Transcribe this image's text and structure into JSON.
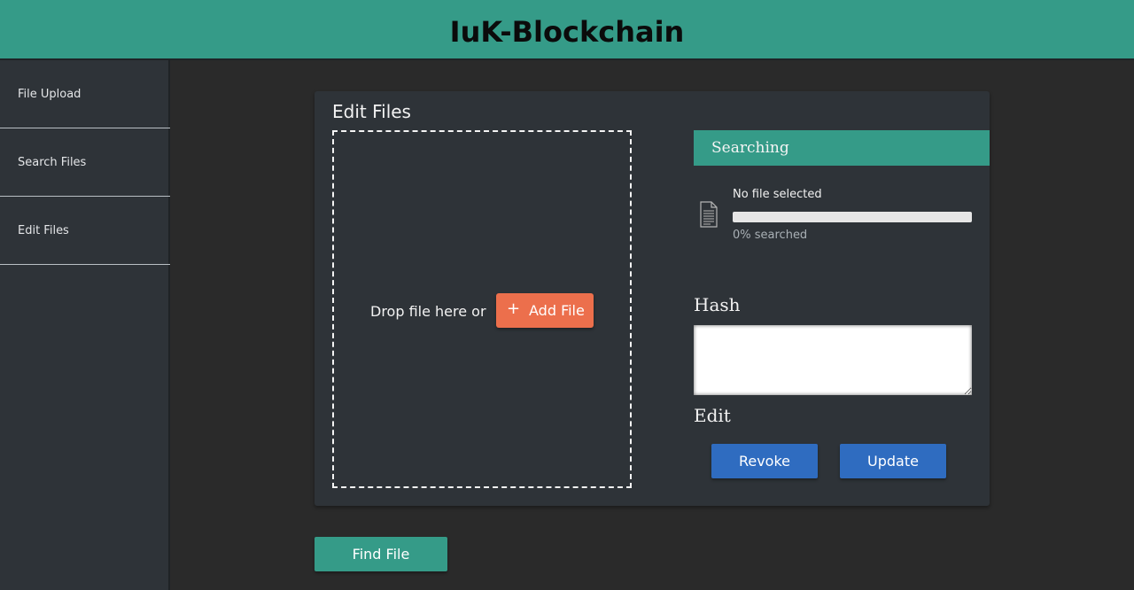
{
  "app": {
    "title": "IuK-Blockchain"
  },
  "sidebar": {
    "items": [
      {
        "label": "File Upload"
      },
      {
        "label": "Search Files"
      },
      {
        "label": "Edit Files"
      }
    ]
  },
  "card": {
    "title": "Edit Files",
    "dropzone": {
      "text": "Drop file here or",
      "add_button": "Add File",
      "add_icon": "plus-icon"
    },
    "status": {
      "header": "Searching",
      "file_name": "No file selected",
      "progress_percent": 0,
      "progress_text": "0% searched",
      "file_icon": "document-icon"
    },
    "hash": {
      "label": "Hash",
      "value": ""
    },
    "edit": {
      "label": "Edit",
      "revoke_button": "Revoke",
      "update_button": "Update"
    }
  },
  "find_button": "Find File",
  "colors": {
    "accent": "#359b88",
    "add_button": "#ec6f4c",
    "primary_button": "#2f6cc0",
    "panel": "#2e3338",
    "background": "#2a2a2a"
  }
}
